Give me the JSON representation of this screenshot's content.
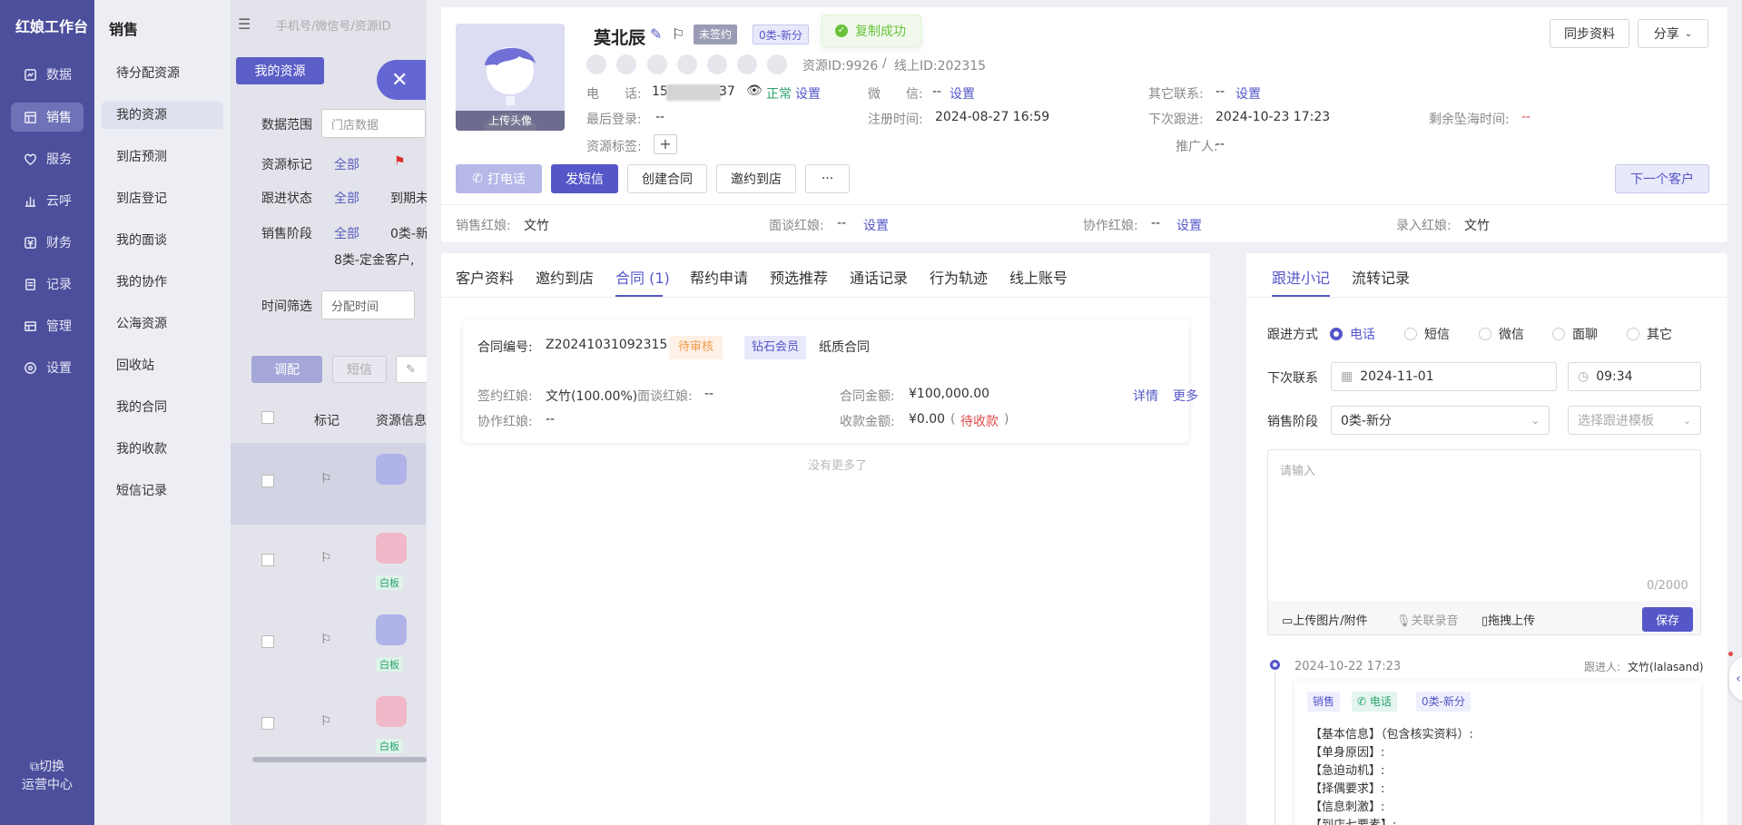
{
  "nav": {
    "logo": "红娘工作台",
    "items": [
      {
        "label": "数据",
        "icon": "chart-icon"
      },
      {
        "label": "销售",
        "icon": "grid-icon"
      },
      {
        "label": "服务",
        "icon": "heart-icon"
      },
      {
        "label": "云呼",
        "icon": "bar-chart-icon"
      },
      {
        "label": "财务",
        "icon": "finance-icon"
      },
      {
        "label": "记录",
        "icon": "record-icon"
      },
      {
        "label": "管理",
        "icon": "manage-icon"
      },
      {
        "label": "设置",
        "icon": "settings-icon"
      }
    ],
    "switch_line1": "切换",
    "switch_line2": "运营中心"
  },
  "submenu": {
    "title": "销售",
    "items": [
      "待分配资源",
      "我的资源",
      "到店预测",
      "到店登记",
      "我的面谈",
      "我的协作",
      "公海资源",
      "回收站",
      "我的合同",
      "我的收款",
      "短信记录"
    ]
  },
  "background": {
    "search_placeholder": "手机号/微信号/资源ID",
    "my_resources_btn": "我的资源",
    "data_scope_label": "数据范围",
    "data_scope_value": "门店数据",
    "resource_tag_label": "资源标记",
    "resource_tag_all": "全部",
    "follow_status_label": "跟进状态",
    "follow_status_all": "全部",
    "follow_status_extra": "到期未",
    "sales_stage_label": "销售阶段",
    "sales_stage_all": "全部",
    "sales_stage_extra": "0类-新",
    "sales_stage_extra2": "8类-定金客户,",
    "time_filter_label": "时间筛选",
    "time_filter_value": "分配时间",
    "btn_adjust": "调配",
    "btn_sms": "短信",
    "col_mark": "标记",
    "col_resource": "资源信息",
    "row_tag": "白板"
  },
  "customer": {
    "avatar_upload": "上传头像",
    "name": "莫北辰",
    "status_unsigned": "未签约",
    "stage_badge": "0类-新分",
    "toast": "复制成功",
    "resource_id": "资源ID:9926",
    "separator": "/",
    "online_id": "线上ID:202315",
    "phone_label": "电　　话:",
    "phone_prefix": "15",
    "phone_suffix": "37",
    "phone_status": "正常",
    "phone_set": "设置",
    "wechat_label": "微　　信:",
    "wechat_value": "--",
    "wechat_set": "设置",
    "other_label": "其它联系:",
    "other_value": "--",
    "other_set": "设置",
    "last_login_label": "最后登录:",
    "last_login_value": "--",
    "register_label": "注册时间:",
    "register_value": "2024-08-27 16:59",
    "next_follow_label": "下次跟进:",
    "next_follow_value": "2024-10-23 17:23",
    "remain_label": "剩余坠海时间:",
    "remain_value": "--",
    "tags_label": "资源标签:",
    "promoter_label": "推广人:",
    "promoter_value": "--",
    "sync_btn": "同步资料",
    "share_btn": "分享",
    "call_btn": "打电话",
    "sms_btn": "发短信",
    "contract_btn": "创建合同",
    "invite_btn": "邀约到店",
    "more_btn": "···",
    "next_customer_btn": "下一个客户",
    "sales_hn_label": "销售红娘:",
    "sales_hn_value": "文竹",
    "interview_hn_label": "面谈红娘:",
    "interview_hn_value": "--",
    "interview_hn_set": "设置",
    "assist_hn_label": "协作红娘:",
    "assist_hn_value": "--",
    "assist_hn_set": "设置",
    "entry_hn_label": "录入红娘:",
    "entry_hn_value": "文竹"
  },
  "tabs": [
    "客户资料",
    "邀约到店",
    "合同 (1)",
    "帮约申请",
    "预选推荐",
    "通话记录",
    "行为轨迹",
    "线上账号"
  ],
  "contract": {
    "no_label": "合同编号:",
    "no_value": "Z20241031092315",
    "status": "待审核",
    "member": "钻石会员",
    "paper": "纸质合同",
    "sign_hn_label": "签约红娘:",
    "sign_hn_value": "文竹(100.00%)",
    "interview_label": "面谈红娘:",
    "interview_value": "--",
    "amount_label": "合同金额:",
    "amount_value": "¥100,000.00",
    "detail_link": "详情",
    "more_link": "更多",
    "assist_label": "协作红娘:",
    "assist_value": "--",
    "received_label": "收款金额:",
    "received_value": "¥0.00",
    "received_paren_open": "(",
    "received_status": "待收款",
    "received_paren_close": ")",
    "no_more": "没有更多了"
  },
  "right_panel": {
    "tabs": [
      "跟进小记",
      "流转记录"
    ],
    "method_label": "跟进方式",
    "methods": [
      "电话",
      "短信",
      "微信",
      "面聊",
      "其它"
    ],
    "next_contact_label": "下次联系",
    "next_date": "2024-11-01",
    "next_time": "09:34",
    "stage_label": "销售阶段",
    "stage_value": "0类-新分",
    "template_placeholder": "选择跟进模板",
    "textarea_placeholder": "请输入",
    "char_count": "0/2000",
    "upload_btn": "上传图片/附件",
    "record_btn": "关联录音",
    "drag_btn": "拖拽上传",
    "save_btn": "保存",
    "record": {
      "time": "2024-10-22 17:23",
      "follower_label": "跟进人:",
      "follower_value": "文竹(lalasand)",
      "tag1": "销售",
      "tag2": "电话",
      "tag3": "0类-新分",
      "lines": [
        "【基本信息】（包含核实资料）:",
        "【单身原因】:",
        "【急迫动机】:",
        "【择偶要求】:",
        "【信息刺激】:",
        "【到店七要素】:"
      ]
    }
  }
}
